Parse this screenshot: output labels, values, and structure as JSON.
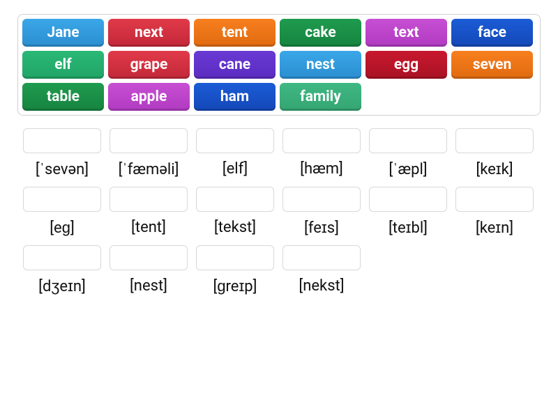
{
  "wordBank": [
    {
      "word": "Jane",
      "color": "lightblue"
    },
    {
      "word": "next",
      "color": "red"
    },
    {
      "word": "tent",
      "color": "orange"
    },
    {
      "word": "cake",
      "color": "green"
    },
    {
      "word": "text",
      "color": "magenta"
    },
    {
      "word": "face",
      "color": "blue"
    },
    {
      "word": "elf",
      "color": "mint"
    },
    {
      "word": "grape",
      "color": "red"
    },
    {
      "word": "cane",
      "color": "purple"
    },
    {
      "word": "nest",
      "color": "lightblue"
    },
    {
      "word": "egg",
      "color": "crimson"
    },
    {
      "word": "seven",
      "color": "orange"
    },
    {
      "word": "table",
      "color": "green"
    },
    {
      "word": "apple",
      "color": "magenta"
    },
    {
      "word": "ham",
      "color": "blue"
    },
    {
      "word": "family",
      "color": "seagreen"
    }
  ],
  "targets": [
    {
      "ipa": "[ˈsevən]"
    },
    {
      "ipa": "[ˈfæməli]"
    },
    {
      "ipa": "[elf]"
    },
    {
      "ipa": "[hæm]"
    },
    {
      "ipa": "[ˈæpl]"
    },
    {
      "ipa": "[keɪk]"
    },
    {
      "ipa": "[eɡ]"
    },
    {
      "ipa": "[tent]"
    },
    {
      "ipa": "[tekst]"
    },
    {
      "ipa": "[feɪs]"
    },
    {
      "ipa": "[teɪbl]"
    },
    {
      "ipa": "[keɪn]"
    },
    {
      "ipa": "[dʒeɪn]"
    },
    {
      "ipa": "[nest]"
    },
    {
      "ipa": "[ɡreɪp]"
    },
    {
      "ipa": "[nekst]"
    }
  ]
}
